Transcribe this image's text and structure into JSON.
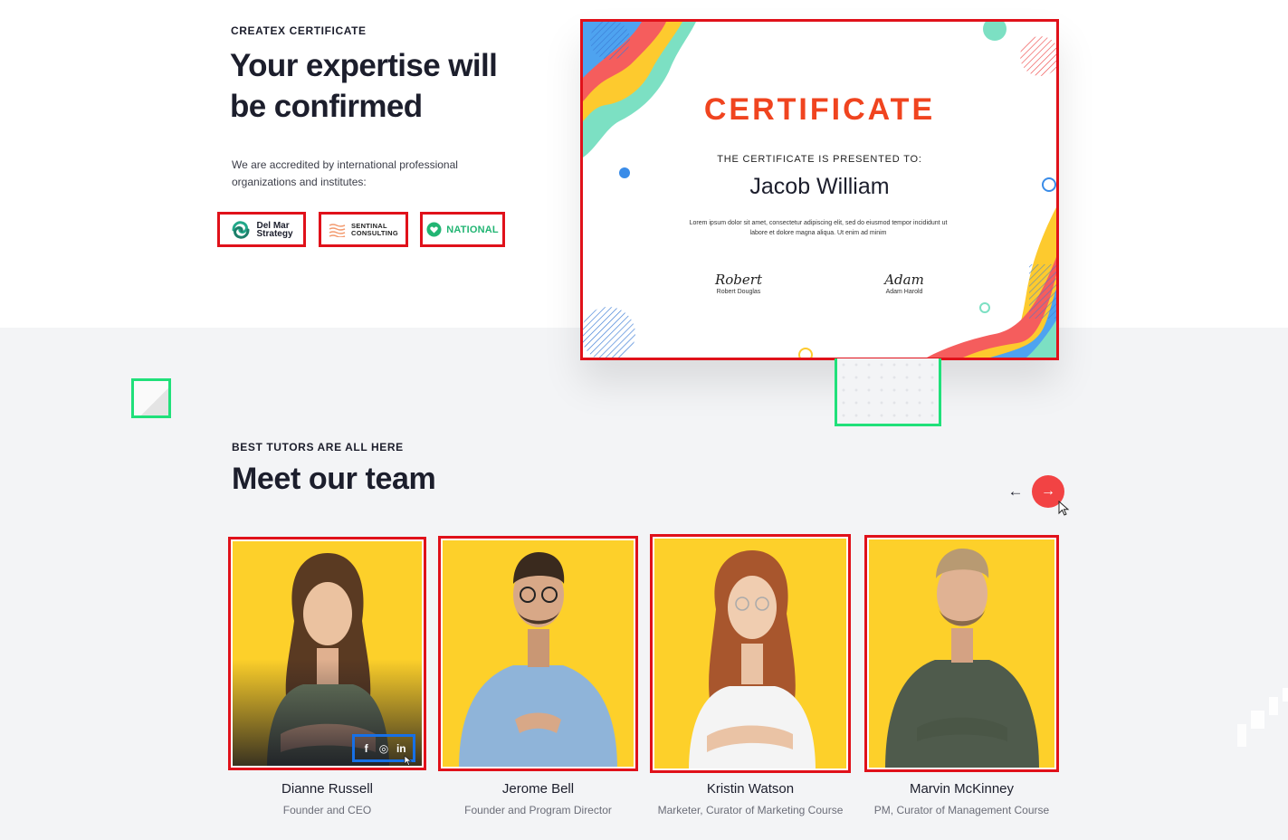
{
  "certificate_section": {
    "eyebrow": "CREATEX CERTIFICATE",
    "headline": "Your expertise will be confirmed",
    "description": "We are accredited by international professional organizations and institutes:",
    "partners": [
      {
        "line1": "Del Mar",
        "line2": "Strategy",
        "icon": "swirl-logo-icon"
      },
      {
        "line1": "SENTINAL",
        "line2": "CONSULTING",
        "icon": "stripes-logo-icon"
      },
      {
        "line1": "NATIONAL",
        "icon": "heart-badge-icon"
      }
    ],
    "certificate": {
      "title": "CERTIFICATE",
      "presented_to": "THE CERTIFICATE IS PRESENTED TO:",
      "recipient": "Jacob William",
      "body": "Lorem ipsum dolor sit amet, consectetur adipiscing elit, sed do eiusmod tempor incididunt ut labore et dolore magna aliqua. Ut enim ad minim",
      "signatures": [
        {
          "script": "Robert",
          "name": "Robert Douglas"
        },
        {
          "script": "Adam",
          "name": "Adam Harold"
        }
      ]
    }
  },
  "team_section": {
    "eyebrow": "BEST TUTORS ARE ALL HERE",
    "headline": "Meet our team",
    "prev_label": "←",
    "next_label": "→",
    "members": [
      {
        "name": "Dianne Russell",
        "role": "Founder and CEO"
      },
      {
        "name": "Jerome Bell",
        "role": "Founder and Program Director"
      },
      {
        "name": "Kristin Watson",
        "role": "Marketer, Curator of Marketing Course"
      },
      {
        "name": "Marvin McKinney",
        "role": "PM, Curator of Management Course"
      }
    ],
    "social": {
      "facebook": "f",
      "instagram": "◎",
      "linkedin": "in"
    }
  },
  "colors": {
    "accent_red": "#f24344",
    "certificate_title": "#f0441f",
    "card_background": "#fdd02a",
    "section_gray": "#f3f4f6",
    "heading": "#1c1e2c"
  }
}
